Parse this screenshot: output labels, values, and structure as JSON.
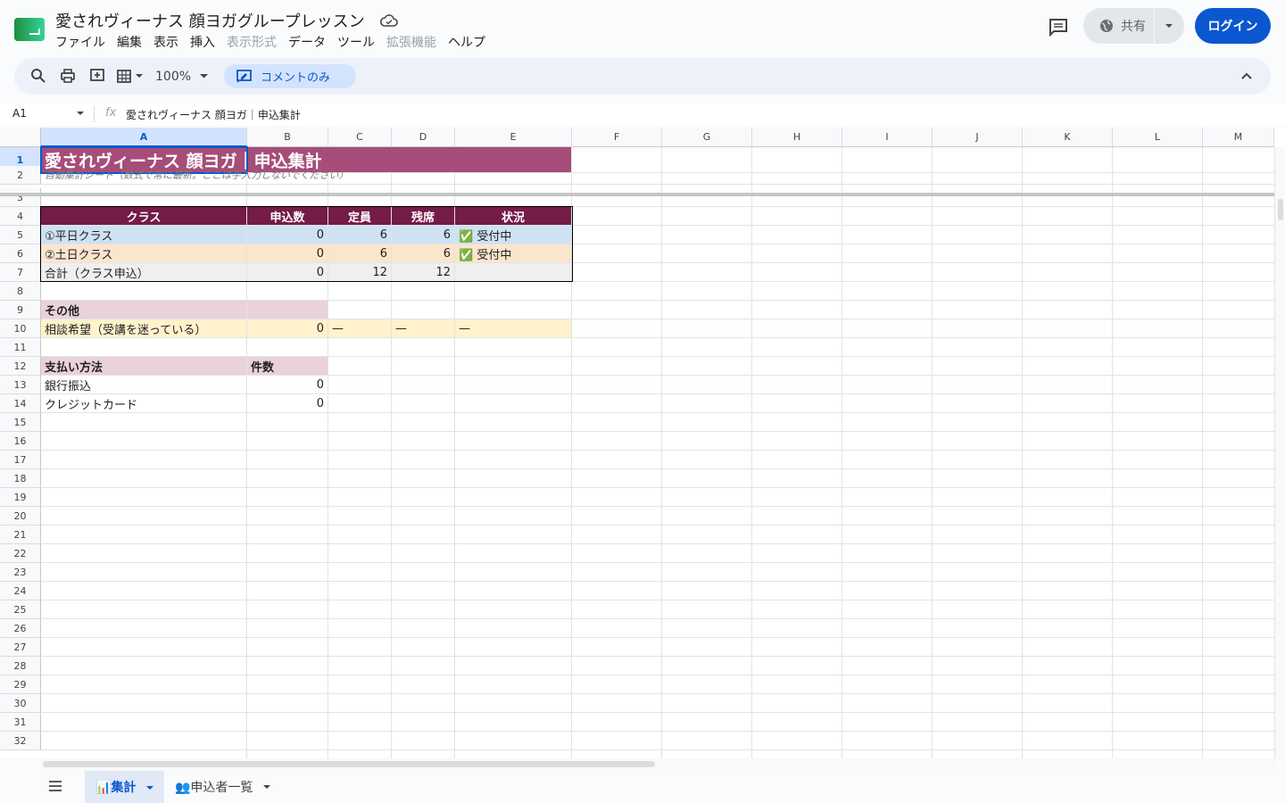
{
  "title": "愛されヴィーナス 顔ヨガグループレッスン",
  "menu": [
    "ファイル",
    "編集",
    "表示",
    "挿入",
    "表示形式",
    "データ",
    "ツール",
    "拡張機能",
    "ヘルプ"
  ],
  "menu_disabled": [
    "表示形式",
    "拡張機能"
  ],
  "share_label": "共有",
  "login_label": "ログイン",
  "zoom": "100%",
  "comment_only": "コメントのみ",
  "namebox": "A1",
  "fx_label": "fx",
  "formula": "愛されヴィーナス 顔ヨガ｜申込集計",
  "columns": [
    "A",
    "B",
    "C",
    "D",
    "E",
    "F",
    "G",
    "H",
    "I",
    "J",
    "K",
    "L",
    "M"
  ],
  "rows": [
    "1",
    "2",
    "3",
    "4",
    "5",
    "6",
    "7",
    "8",
    "9",
    "10",
    "11",
    "12",
    "13",
    "14",
    "15",
    "16",
    "17",
    "18",
    "19",
    "20",
    "21",
    "22",
    "23",
    "24",
    "25",
    "26",
    "27",
    "28",
    "29",
    "30",
    "31",
    "32"
  ],
  "sheet": {
    "title": "愛されヴィーナス 顔ヨガ｜申込集計",
    "subtitle": "自動集計シート（数式で常に最新。ここは手入力しないでください）",
    "class_table": {
      "headers": [
        "クラス",
        "申込数",
        "定員",
        "残席",
        "状況"
      ],
      "rows": [
        [
          "①平日クラス",
          "0",
          "6",
          "6",
          "✅ 受付中"
        ],
        [
          "②土日クラス",
          "0",
          "6",
          "6",
          "✅ 受付中"
        ],
        [
          "合計（クラス申込）",
          "0",
          "12",
          "12",
          ""
        ]
      ]
    },
    "other": {
      "header": "その他",
      "label": "相談希望（受講を迷っている）",
      "value": "0",
      "c": "—",
      "d": "—",
      "e": "—"
    },
    "payment": {
      "headers": [
        "支払い方法",
        "件数"
      ],
      "rows": [
        [
          "銀行振込",
          "0"
        ],
        [
          "クレジットカード",
          "0"
        ]
      ]
    }
  },
  "tabs": {
    "active": "📊集計",
    "second": "👥申込者一覧"
  },
  "colors": {
    "title_bg": "#a64d79",
    "header_bg": "#741b47",
    "row_blue": "#cfe2f3",
    "row_orange": "#fce5cd",
    "row_gray": "#efefef",
    "pink": "#ead1dc",
    "yellow": "#fff2cc",
    "accent": "#0b57d0"
  }
}
